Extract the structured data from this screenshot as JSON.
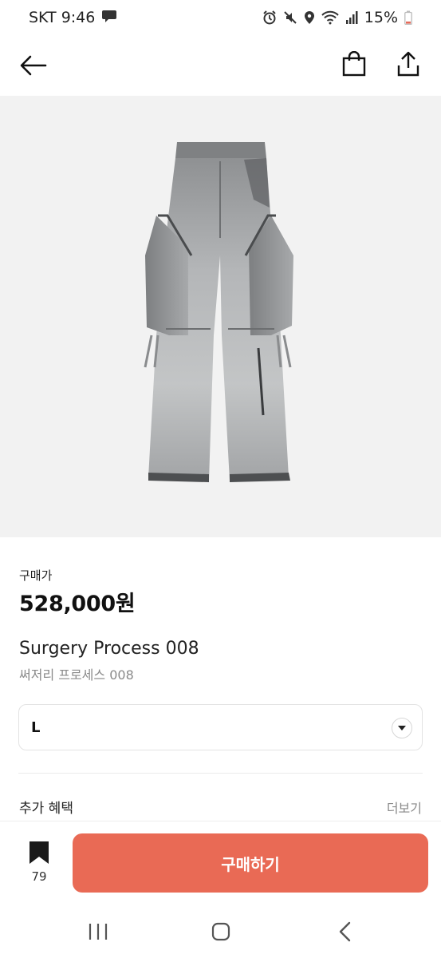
{
  "status_bar": {
    "carrier_time": "SKT 9:46",
    "battery": "15%",
    "icons": [
      "chat-bubble-icon",
      "alarm-icon",
      "mute-icon",
      "location-icon",
      "wifi-icon",
      "signal-icon",
      "battery-icon"
    ]
  },
  "app_bar": {
    "icons": [
      "back-arrow-icon",
      "shopping-bag-icon",
      "share-icon"
    ]
  },
  "product": {
    "image": "grey-denim-cargo-pants",
    "price_label": "구매가",
    "price": "528,000원",
    "name": "Surgery Process 008",
    "subname": "써저리 프로세스 008"
  },
  "size_select": {
    "value": "L"
  },
  "benefits": {
    "label": "추가 혜택",
    "more": "더보기"
  },
  "bottom_bar": {
    "bookmark_count": "79",
    "buy_label": "구매하기",
    "accent": "#e96a55"
  },
  "nav_bar": {
    "icons": [
      "recent-apps-icon",
      "home-icon",
      "nav-back-icon"
    ]
  }
}
